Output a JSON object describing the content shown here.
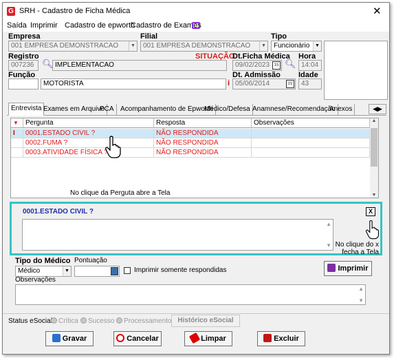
{
  "window": {
    "title": "SRH - Cadastro de Ficha Médica",
    "app_icon": "G"
  },
  "menu": {
    "items": [
      "Saída",
      "Imprimir",
      "Cadastro de epworth",
      "Cadastro de Exames"
    ]
  },
  "header": {
    "empresa_label": "Empresa",
    "empresa_value": "001 EMPRESA DEMONSTRACAO",
    "filial_label": "Filial",
    "filial_value": "001 EMPRESA DEMONSTRACAO",
    "tipo_label": "Tipo",
    "tipo_value": "Funcionário",
    "registro_label": "Registro",
    "registro_value": "007236",
    "situacao_label": "SITUAÇÃO",
    "situacao_value": "IMPLEMENTACAO",
    "dt_ficha_label": "Dt.Ficha Médica",
    "dt_ficha_value": "09/02/2023",
    "hora_label": "Hora",
    "hora_value": "14:04",
    "funcao_label": "Função",
    "funcao_value": "MOTORISTA",
    "dt_admissao_label": "Dt. Admissão",
    "dt_admissao_value": "05/06/2014",
    "idade_label": "Idade",
    "idade_value": "43",
    "info_icon": "i"
  },
  "tabs": [
    "Entrevista",
    "Exames em Arquivo",
    "PCA",
    "Acompanhamento de Epworth",
    "Médico/Defesa",
    "Anamnese/Recomendação",
    "Anexos"
  ],
  "grid": {
    "headers": [
      "Pergunta",
      "Resposta",
      "Observações"
    ],
    "rows": [
      {
        "pergunta": "0001.ESTADO CIVIL ?",
        "resposta": "NÃO RESPONDIDA",
        "obs": ""
      },
      {
        "pergunta": "0002.FUMA ?",
        "resposta": "NÃO RESPONDIDA",
        "obs": ""
      },
      {
        "pergunta": "0003.ATIVIDADE FÍSICA ?",
        "resposta": "NÃO RESPONDIDA",
        "obs": ""
      }
    ],
    "annotation": "No clique da Perguta abre a Tela"
  },
  "detail": {
    "question": "0001.ESTADO CIVIL ?",
    "close_label": "X",
    "annotation_line1": "No clique do x",
    "annotation_line2": "fecha a Tela"
  },
  "bottom": {
    "tipo_medico_label": "Tipo do Médico",
    "tipo_medico_value": "Médico",
    "pontuacao_label": "Pontuação",
    "imprimir_resp_label": "Imprimir somente respondidas",
    "imprimir_button": "Imprimir",
    "observacoes_label": "Observações"
  },
  "status": {
    "label": "Status eSocial:",
    "options": [
      "Crítica",
      "Sucesso",
      "Processamento"
    ],
    "historico_button": "Histórico eSocial"
  },
  "actions": {
    "gravar": "Gravar",
    "cancelar": "Cancelar",
    "limpar": "Limpar",
    "excluir": "Excluir"
  },
  "colors": {
    "accent_teal": "#37c3c3",
    "alert_red": "#e01b1b",
    "question_blue": "#1a2fb0"
  }
}
